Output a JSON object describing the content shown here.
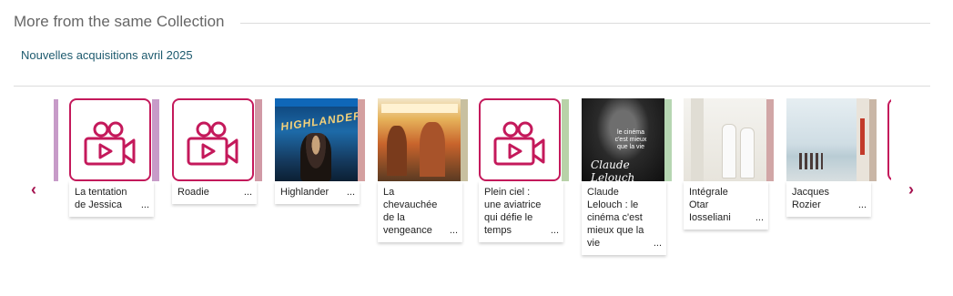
{
  "section": {
    "title": "More from the same Collection",
    "collection_link": "Nouvelles acquisitions avril 2025"
  },
  "carousel": {
    "prev_icon": "chevron-left-icon",
    "next_icon": "chevron-right-icon",
    "more_label": "...",
    "accent_color": "#c4195b",
    "items": [
      {
        "title": "La tentation de Jessica",
        "cover": "video-placeholder-icon",
        "spine_color": "#c79bc8"
      },
      {
        "title": "Roadie",
        "cover": "video-placeholder-icon",
        "spine_color": "#d19aa6"
      },
      {
        "title": "Highlander",
        "cover": "highlander-cover",
        "spine_color": "#d4a0a0"
      },
      {
        "title": "La chevauchée de la vengeance",
        "cover": "chevauchee-cover",
        "spine_color": "#c8c0a0"
      },
      {
        "title": "Plein ciel : une aviatrice qui défie le temps",
        "cover": "video-placeholder-icon",
        "spine_color": "#b8d2a8"
      },
      {
        "title": "Claude Lelouch : le cinéma c'est mieux que la vie",
        "cover": "lelouch-cover",
        "cover_text_1": "le cinéma c'est mieux que la vie",
        "cover_text_2": "Claude Lelouch",
        "spine_color": "#b6d6b2"
      },
      {
        "title": "Intégrale Otar Iosseliani",
        "cover": "otar-cover",
        "spine_color": "#d1a6a6"
      },
      {
        "title": "Jacques Rozier",
        "cover": "rozier-cover",
        "spine_color": "#c9b6a6"
      }
    ]
  }
}
